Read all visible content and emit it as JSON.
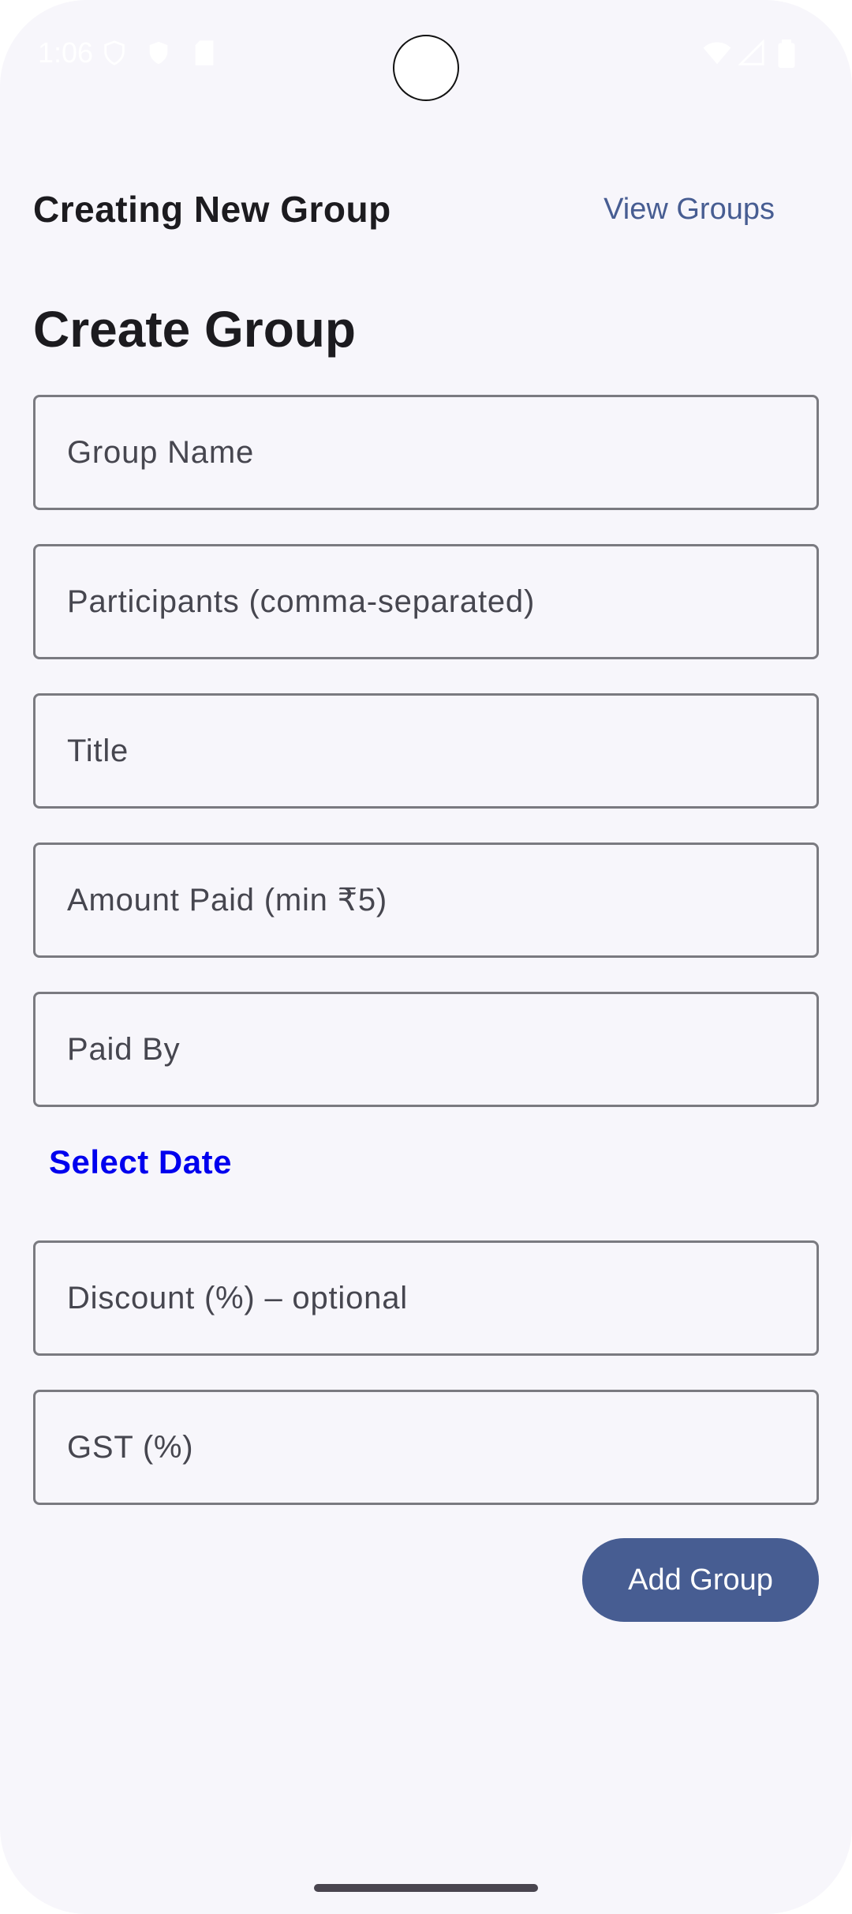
{
  "status_bar": {
    "time": "1:06"
  },
  "header": {
    "title": "Creating New Group",
    "view_groups_label": "View Groups"
  },
  "form": {
    "heading": "Create Group",
    "group_name_placeholder": "Group Name",
    "participants_placeholder": "Participants (comma-separated)",
    "title_placeholder": "Title",
    "amount_placeholder": "Amount Paid (min ₹5)",
    "paid_by_placeholder": "Paid By",
    "select_date_label": "Select Date",
    "discount_placeholder": "Discount (%) – optional",
    "gst_placeholder": "GST (%)",
    "submit_label": "Add Group"
  },
  "colors": {
    "background": "#f7f6fb",
    "accent": "#475d92",
    "link": "#0000ee"
  }
}
